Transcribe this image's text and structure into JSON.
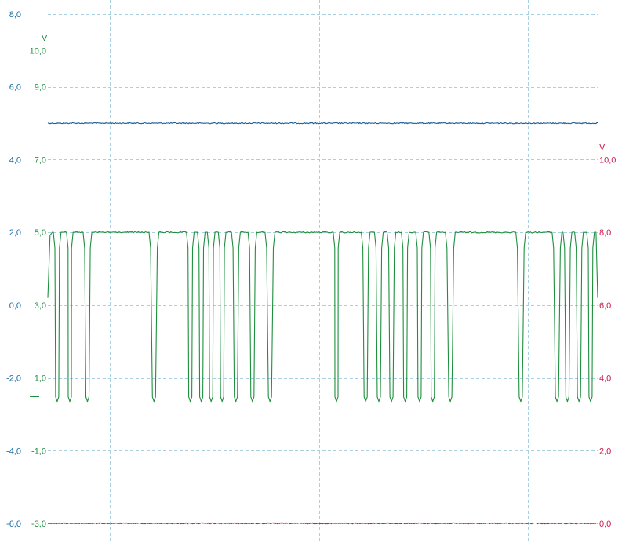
{
  "chart_data": {
    "type": "line",
    "grid": true,
    "legend": "none",
    "x": {
      "range": [
        0,
        1
      ],
      "gridlines": [
        0.113,
        0.493,
        0.873
      ]
    },
    "axes": [
      {
        "id": "blue",
        "side": "left",
        "color": "#1a6ea3",
        "unit": "",
        "ylim": [
          -6,
          8
        ],
        "ticks": [
          8,
          6,
          4,
          2,
          0,
          -2,
          -4,
          -6
        ],
        "tick_labels": [
          "8,0",
          "6,0",
          "4,0",
          "2,0",
          "0,0",
          "-2,0",
          "-4,0",
          "-6,0"
        ]
      },
      {
        "id": "green",
        "side": "left-inner",
        "color": "#1e8f3e",
        "unit": "V",
        "ylim": [
          -3,
          11
        ],
        "ticks": [
          10,
          9,
          7,
          5,
          3,
          1,
          -1,
          -3
        ],
        "tick_labels": [
          "10,0",
          "9,0",
          "7,0",
          "5,0",
          "3,0",
          "1,0",
          "-1,0",
          "-3,0"
        ]
      },
      {
        "id": "red",
        "side": "right",
        "color": "#cc1a4a",
        "unit": "V",
        "ylim": [
          0,
          14
        ],
        "ticks": [
          10,
          8,
          6,
          4,
          2,
          0
        ],
        "tick_labels": [
          "10,0",
          "8,0",
          "6,0",
          "4,0",
          "2,0",
          "0,0"
        ]
      }
    ],
    "series": [
      {
        "axis": "blue",
        "color": "#1a5f9a",
        "kind": "constant",
        "value": 5.0
      },
      {
        "axis": "green",
        "color": "#1e8f3e",
        "kind": "pulses",
        "high": 5.0,
        "low": 0.35,
        "start": 3.2,
        "end": 3.2,
        "pulses": [
          [
            0.01,
            0.024
          ],
          [
            0.034,
            0.046
          ],
          [
            0.064,
            0.08
          ],
          [
            0.184,
            0.202
          ],
          [
            0.252,
            0.266
          ],
          [
            0.272,
            0.286
          ],
          [
            0.29,
            0.304
          ],
          [
            0.31,
            0.324
          ],
          [
            0.334,
            0.35
          ],
          [
            0.364,
            0.38
          ],
          [
            0.395,
            0.413
          ],
          [
            0.519,
            0.531
          ],
          [
            0.57,
            0.586
          ],
          [
            0.594,
            0.61
          ],
          [
            0.617,
            0.633
          ],
          [
            0.643,
            0.657
          ],
          [
            0.669,
            0.683
          ],
          [
            0.693,
            0.707
          ],
          [
            0.723,
            0.741
          ],
          [
            0.851,
            0.869
          ],
          [
            0.917,
            0.935
          ],
          [
            0.937,
            0.953
          ],
          [
            0.958,
            0.974
          ],
          [
            0.98,
            0.994
          ]
        ]
      },
      {
        "axis": "red",
        "color": "#cc1a4a",
        "kind": "constant",
        "value": 0.0
      }
    ],
    "marker": {
      "axis": "green",
      "value": 0.5,
      "color": "#1e8f3e"
    }
  }
}
